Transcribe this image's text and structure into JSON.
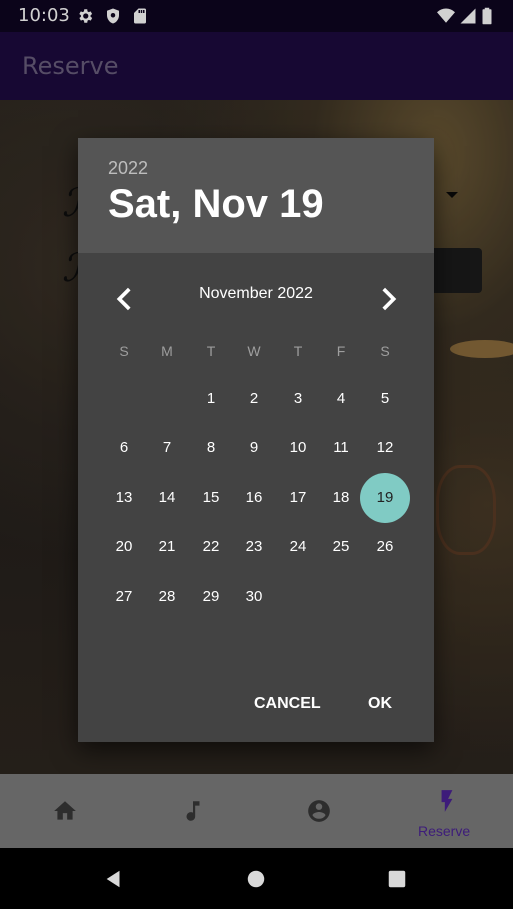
{
  "status_bar": {
    "time": "10:03",
    "icons": [
      "settings-icon",
      "shield-icon",
      "sd-card-icon",
      "wifi-icon",
      "signal-icon",
      "battery-icon"
    ]
  },
  "app_bar": {
    "title": "Reserve"
  },
  "date_picker": {
    "year": "2022",
    "header_date": "Sat, Nov 19",
    "month_label": "November 2022",
    "weekdays": [
      "S",
      "M",
      "T",
      "W",
      "T",
      "F",
      "S"
    ],
    "days": [
      "1",
      "2",
      "3",
      "4",
      "5",
      "6",
      "7",
      "8",
      "9",
      "10",
      "11",
      "12",
      "13",
      "14",
      "15",
      "16",
      "17",
      "18",
      "19",
      "20",
      "21",
      "22",
      "23",
      "24",
      "25",
      "26",
      "27",
      "28",
      "29",
      "30"
    ],
    "selected_day": "19",
    "first_weekday_index": 2,
    "cancel_label": "CANCEL",
    "ok_label": "OK",
    "selected_color": "#80cbc4"
  },
  "bottom_nav": {
    "items": [
      {
        "icon": "home-icon"
      },
      {
        "icon": "music-note-icon"
      },
      {
        "icon": "account-icon"
      },
      {
        "icon": "flash-icon",
        "label": "Reserve"
      }
    ]
  },
  "system_nav": {
    "icons": [
      "back-icon",
      "home-circle-icon",
      "recents-icon"
    ]
  }
}
